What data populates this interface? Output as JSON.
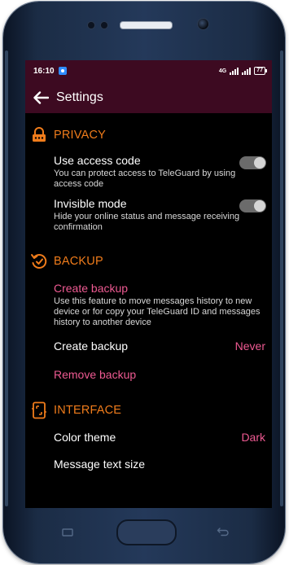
{
  "statusbar": {
    "time": "16:10",
    "network": "4G",
    "battery": "77"
  },
  "appbar": {
    "title": "Settings",
    "back_icon": "arrow-left-icon"
  },
  "sections": {
    "privacy": {
      "title": "PRIVACY",
      "icon": "lock-icon",
      "access_code": {
        "label": "Use access code",
        "desc": "You can protect access to TeleGuard by using access code",
        "enabled": false
      },
      "invisible": {
        "label": "Invisible mode",
        "desc": "Hide your online status and message receiving confirmation",
        "enabled": false
      }
    },
    "backup": {
      "title": "BACKUP",
      "icon": "backup-restore-icon",
      "create_link": {
        "label": "Create backup",
        "desc": "Use this feature to move messages history to new device or for copy your TeleGuard ID and messages history to another device"
      },
      "schedule": {
        "label": "Create backup",
        "value": "Never"
      },
      "remove": {
        "label": "Remove backup"
      }
    },
    "interface": {
      "title": "INTERFACE",
      "icon": "interface-icon",
      "color_theme": {
        "label": "Color theme",
        "value": "Dark"
      },
      "text_size": {
        "label": "Message text size"
      }
    }
  },
  "colors": {
    "accent_orange": "#f07c1b",
    "accent_pink": "#ee5a92",
    "appbar": "#3d0a21",
    "background": "#000000"
  }
}
